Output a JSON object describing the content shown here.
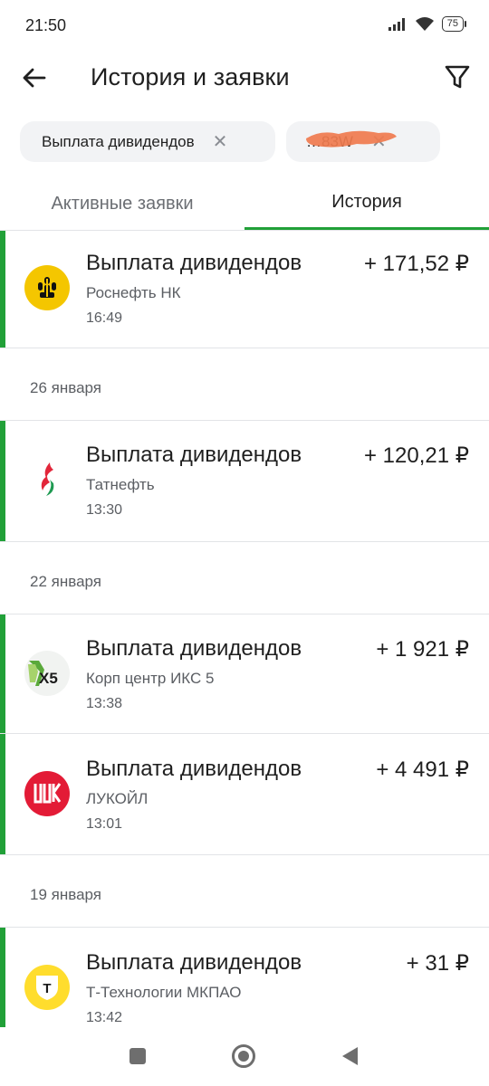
{
  "status_bar": {
    "time": "21:50",
    "battery": "75"
  },
  "header": {
    "title": "История и заявки",
    "back_icon": "arrow-left-icon",
    "filter_icon": "filter-icon"
  },
  "filters": {
    "chips": [
      {
        "label": "Выплата дивидендов"
      },
      {
        "label": "…83W"
      }
    ],
    "clear_icon": "close-icon"
  },
  "tabs": {
    "items": [
      {
        "label": "Активные заявки",
        "active": false
      },
      {
        "label": "История",
        "active": true
      }
    ]
  },
  "colors": {
    "accent_green": "#21a038",
    "rosneft_yellow": "#f4c600",
    "lukoil_red": "#e31b36",
    "x5_green": "#5aa93a",
    "ttech_yellow": "#ffdd2d"
  },
  "groups": [
    {
      "date": "",
      "items": [
        {
          "title": "Выплата дивидендов",
          "company": "Роснефть НК",
          "time": "16:49",
          "amount": "+ 171,52 ₽",
          "logo": "rosneft-logo"
        }
      ]
    },
    {
      "date": "26 января",
      "items": [
        {
          "title": "Выплата дивидендов",
          "company": "Татнефть",
          "time": "13:30",
          "amount": "+ 120,21 ₽",
          "logo": "tatneft-logo"
        }
      ]
    },
    {
      "date": "22 января",
      "items": [
        {
          "title": "Выплата дивидендов",
          "company": "Корп центр ИКС 5",
          "time": "13:38",
          "amount": "+ 1 921 ₽",
          "logo": "x5-logo",
          "logo_text": "X5"
        },
        {
          "title": "Выплата дивидендов",
          "company": "ЛУКОЙЛ",
          "time": "13:01",
          "amount": "+ 4 491 ₽",
          "logo": "lukoil-logo"
        }
      ]
    },
    {
      "date": "19 января",
      "items": [
        {
          "title": "Выплата дивидендов",
          "company": "Т-Технологии МКПАО",
          "time": "13:42",
          "amount": "+ 31 ₽",
          "logo": "t-technologies-logo",
          "logo_text": "Т"
        }
      ]
    }
  ],
  "nav_bar": {
    "icons": [
      "recents-square-icon",
      "home-circle-icon",
      "back-triangle-icon"
    ]
  }
}
